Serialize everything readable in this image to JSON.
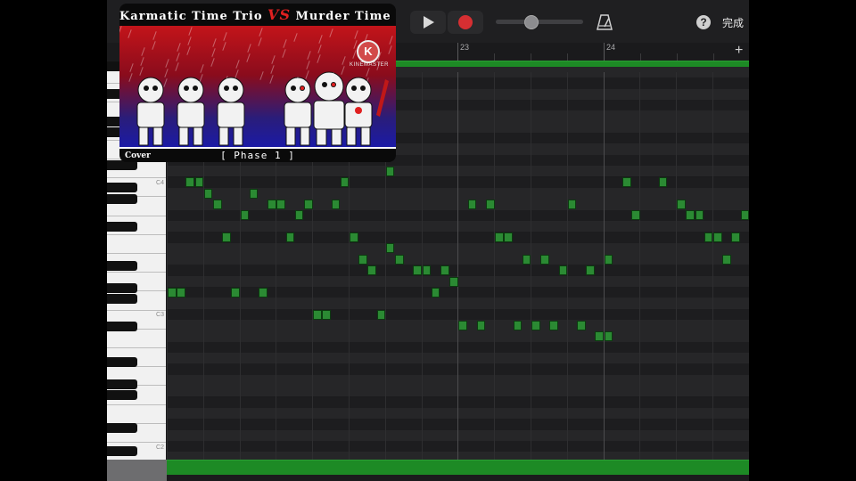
{
  "toolbar": {
    "help_label": "?",
    "done_label": "完成",
    "icons": [
      "play-icon",
      "record-icon",
      "volume-slider",
      "metronome-icon",
      "help-icon"
    ],
    "tempo_slider_level": 0.33
  },
  "ruler": {
    "bars": [
      "23",
      "24"
    ],
    "add_label": "+"
  },
  "keyboard": {
    "labels": [
      "C4",
      "C3",
      "C2"
    ]
  },
  "video_overlay": {
    "title_left": "Karmatic Time Trio",
    "title_vs": "VS",
    "title_right": "Murder Time Trio",
    "watermark": "KINEMASTER",
    "cover_label": "Cover",
    "phase_label": "[ Phase 1 ]"
  },
  "colors": {
    "note_green": "#2b8a33",
    "region_green": "#1d8a25",
    "record_red": "#d62f32",
    "background": "#1b1b1d"
  },
  "notes": [
    {
      "row": 0,
      "col": 24
    },
    {
      "row": 1,
      "col": 2
    },
    {
      "row": 1,
      "col": 3
    },
    {
      "row": 1,
      "col": 19
    },
    {
      "row": 1,
      "col": 50
    },
    {
      "row": 1,
      "col": 54
    },
    {
      "row": 2,
      "col": 4
    },
    {
      "row": 2,
      "col": 9
    },
    {
      "row": 3,
      "col": 5
    },
    {
      "row": 3,
      "col": 11
    },
    {
      "row": 3,
      "col": 12
    },
    {
      "row": 3,
      "col": 15
    },
    {
      "row": 3,
      "col": 18
    },
    {
      "row": 3,
      "col": 33
    },
    {
      "row": 3,
      "col": 35
    },
    {
      "row": 3,
      "col": 44
    },
    {
      "row": 3,
      "col": 56
    },
    {
      "row": 4,
      "col": 8
    },
    {
      "row": 4,
      "col": 14
    },
    {
      "row": 4,
      "col": 51
    },
    {
      "row": 4,
      "col": 57
    },
    {
      "row": 4,
      "col": 58
    },
    {
      "row": 4,
      "col": 63
    },
    {
      "row": 6,
      "col": 6
    },
    {
      "row": 6,
      "col": 13
    },
    {
      "row": 6,
      "col": 20
    },
    {
      "row": 6,
      "col": 36
    },
    {
      "row": 6,
      "col": 37
    },
    {
      "row": 6,
      "col": 59
    },
    {
      "row": 6,
      "col": 60
    },
    {
      "row": 6,
      "col": 62
    },
    {
      "row": 7,
      "col": 24
    },
    {
      "row": 8,
      "col": 21
    },
    {
      "row": 8,
      "col": 25
    },
    {
      "row": 8,
      "col": 39
    },
    {
      "row": 8,
      "col": 41
    },
    {
      "row": 8,
      "col": 48
    },
    {
      "row": 8,
      "col": 61
    },
    {
      "row": 9,
      "col": 22
    },
    {
      "row": 9,
      "col": 27
    },
    {
      "row": 9,
      "col": 28
    },
    {
      "row": 9,
      "col": 30
    },
    {
      "row": 9,
      "col": 43
    },
    {
      "row": 9,
      "col": 46
    },
    {
      "row": 10,
      "col": 31
    },
    {
      "row": 11,
      "col": 0
    },
    {
      "row": 11,
      "col": 1
    },
    {
      "row": 11,
      "col": 7
    },
    {
      "row": 11,
      "col": 10
    },
    {
      "row": 11,
      "col": 29
    },
    {
      "row": 13,
      "col": 16
    },
    {
      "row": 13,
      "col": 17
    },
    {
      "row": 13,
      "col": 23
    },
    {
      "row": 14,
      "col": 32
    },
    {
      "row": 14,
      "col": 34
    },
    {
      "row": 14,
      "col": 38
    },
    {
      "row": 14,
      "col": 40
    },
    {
      "row": 14,
      "col": 42
    },
    {
      "row": 14,
      "col": 45
    },
    {
      "row": 15,
      "col": 47
    },
    {
      "row": 15,
      "col": 48
    }
  ]
}
